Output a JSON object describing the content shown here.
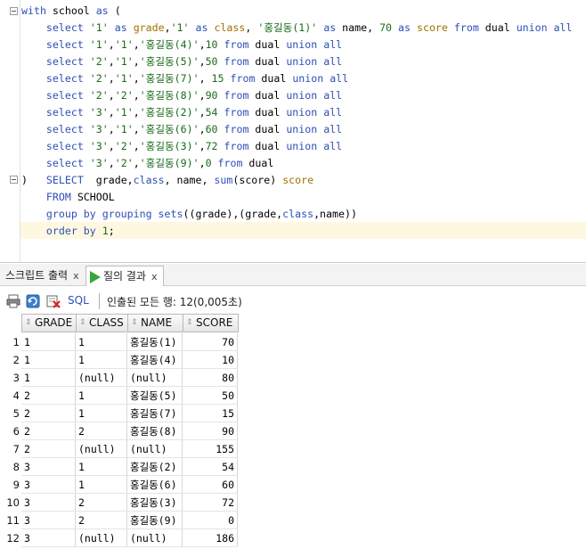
{
  "editor": {
    "lines": [
      [
        [
          "kw",
          "with"
        ],
        [
          "t",
          " school "
        ],
        [
          "kw",
          "as"
        ],
        [
          "t",
          " ("
        ]
      ],
      [
        [
          "t",
          "    "
        ],
        [
          "kw",
          "select"
        ],
        [
          "t",
          " "
        ],
        [
          "str",
          "'1'"
        ],
        [
          "t",
          " "
        ],
        [
          "kw",
          "as"
        ],
        [
          "t",
          " "
        ],
        [
          "ident",
          "grade"
        ],
        [
          "t",
          ","
        ],
        [
          "str",
          "'1'"
        ],
        [
          "t",
          " "
        ],
        [
          "kw",
          "as"
        ],
        [
          "t",
          " "
        ],
        [
          "ident",
          "class"
        ],
        [
          "t",
          ", "
        ],
        [
          "str",
          "'홍길동(1)'"
        ],
        [
          "t",
          " "
        ],
        [
          "kw",
          "as"
        ],
        [
          "t",
          " name, "
        ],
        [
          "num",
          "70"
        ],
        [
          "t",
          " "
        ],
        [
          "kw",
          "as"
        ],
        [
          "t",
          " "
        ],
        [
          "ident",
          "score"
        ],
        [
          "t",
          " "
        ],
        [
          "kw",
          "from"
        ],
        [
          "t",
          " dual "
        ],
        [
          "kw",
          "union all"
        ]
      ],
      [
        [
          "t",
          "    "
        ],
        [
          "kw",
          "select"
        ],
        [
          "t",
          " "
        ],
        [
          "str",
          "'1'"
        ],
        [
          "t",
          ","
        ],
        [
          "str",
          "'1'"
        ],
        [
          "t",
          ","
        ],
        [
          "str",
          "'홍길동(4)'"
        ],
        [
          "t",
          ","
        ],
        [
          "num",
          "10"
        ],
        [
          "t",
          " "
        ],
        [
          "kw",
          "from"
        ],
        [
          "t",
          " dual "
        ],
        [
          "kw",
          "union all"
        ]
      ],
      [
        [
          "t",
          "    "
        ],
        [
          "kw",
          "select"
        ],
        [
          "t",
          " "
        ],
        [
          "str",
          "'2'"
        ],
        [
          "t",
          ","
        ],
        [
          "str",
          "'1'"
        ],
        [
          "t",
          ","
        ],
        [
          "str",
          "'홍길동(5)'"
        ],
        [
          "t",
          ","
        ],
        [
          "num",
          "50"
        ],
        [
          "t",
          " "
        ],
        [
          "kw",
          "from"
        ],
        [
          "t",
          " dual "
        ],
        [
          "kw",
          "union all"
        ]
      ],
      [
        [
          "t",
          "    "
        ],
        [
          "kw",
          "select"
        ],
        [
          "t",
          " "
        ],
        [
          "str",
          "'2'"
        ],
        [
          "t",
          ","
        ],
        [
          "str",
          "'1'"
        ],
        [
          "t",
          ","
        ],
        [
          "str",
          "'홍길동(7)'"
        ],
        [
          "t",
          ", "
        ],
        [
          "num",
          "15"
        ],
        [
          "t",
          " "
        ],
        [
          "kw",
          "from"
        ],
        [
          "t",
          " dual "
        ],
        [
          "kw",
          "union all"
        ]
      ],
      [
        [
          "t",
          "    "
        ],
        [
          "kw",
          "select"
        ],
        [
          "t",
          " "
        ],
        [
          "str",
          "'2'"
        ],
        [
          "t",
          ","
        ],
        [
          "str",
          "'2'"
        ],
        [
          "t",
          ","
        ],
        [
          "str",
          "'홍길동(8)'"
        ],
        [
          "t",
          ","
        ],
        [
          "num",
          "90"
        ],
        [
          "t",
          " "
        ],
        [
          "kw",
          "from"
        ],
        [
          "t",
          " dual "
        ],
        [
          "kw",
          "union all"
        ]
      ],
      [
        [
          "t",
          "    "
        ],
        [
          "kw",
          "select"
        ],
        [
          "t",
          " "
        ],
        [
          "str",
          "'3'"
        ],
        [
          "t",
          ","
        ],
        [
          "str",
          "'1'"
        ],
        [
          "t",
          ","
        ],
        [
          "str",
          "'홍길동(2)'"
        ],
        [
          "t",
          ","
        ],
        [
          "num",
          "54"
        ],
        [
          "t",
          " "
        ],
        [
          "kw",
          "from"
        ],
        [
          "t",
          " dual "
        ],
        [
          "kw",
          "union all"
        ]
      ],
      [
        [
          "t",
          "    "
        ],
        [
          "kw",
          "select"
        ],
        [
          "t",
          " "
        ],
        [
          "str",
          "'3'"
        ],
        [
          "t",
          ","
        ],
        [
          "str",
          "'1'"
        ],
        [
          "t",
          ","
        ],
        [
          "str",
          "'홍길동(6)'"
        ],
        [
          "t",
          ","
        ],
        [
          "num",
          "60"
        ],
        [
          "t",
          " "
        ],
        [
          "kw",
          "from"
        ],
        [
          "t",
          " dual "
        ],
        [
          "kw",
          "union all"
        ]
      ],
      [
        [
          "t",
          "    "
        ],
        [
          "kw",
          "select"
        ],
        [
          "t",
          " "
        ],
        [
          "str",
          "'3'"
        ],
        [
          "t",
          ","
        ],
        [
          "str",
          "'2'"
        ],
        [
          "t",
          ","
        ],
        [
          "str",
          "'홍길동(3)'"
        ],
        [
          "t",
          ","
        ],
        [
          "num",
          "72"
        ],
        [
          "t",
          " "
        ],
        [
          "kw",
          "from"
        ],
        [
          "t",
          " dual "
        ],
        [
          "kw",
          "union all"
        ]
      ],
      [
        [
          "t",
          "    "
        ],
        [
          "kw",
          "select"
        ],
        [
          "t",
          " "
        ],
        [
          "str",
          "'3'"
        ],
        [
          "t",
          ","
        ],
        [
          "str",
          "'2'"
        ],
        [
          "t",
          ","
        ],
        [
          "str",
          "'홍길동(9)'"
        ],
        [
          "t",
          ","
        ],
        [
          "num",
          "0"
        ],
        [
          "t",
          " "
        ],
        [
          "kw",
          "from"
        ],
        [
          "t",
          " dual"
        ]
      ],
      [
        [
          "t",
          ")   "
        ],
        [
          "kw",
          "SELECT"
        ],
        [
          "t",
          "  grade,"
        ],
        [
          "kw",
          "class"
        ],
        [
          "t",
          ", name, "
        ],
        [
          "fn",
          "sum"
        ],
        [
          "t",
          "(score) "
        ],
        [
          "ident",
          "score"
        ]
      ],
      [
        [
          "t",
          "    "
        ],
        [
          "kw",
          "FROM"
        ],
        [
          "t",
          " SCHOOL"
        ]
      ],
      [
        [
          "t",
          "    "
        ],
        [
          "kw",
          "group by grouping sets"
        ],
        [
          "t",
          "((grade),(grade,"
        ],
        [
          "kw",
          "class"
        ],
        [
          "t",
          ",name))"
        ]
      ],
      [
        [
          "t",
          "    "
        ],
        [
          "kw",
          "order by"
        ],
        [
          "t",
          " "
        ],
        [
          "num",
          "1"
        ],
        [
          "t",
          ";"
        ]
      ]
    ]
  },
  "tabs": {
    "script_output": "스크립트 출력",
    "script_close": "x",
    "query_result": "질의 결과",
    "query_close": "x"
  },
  "toolbar": {
    "sql_label": "SQL",
    "status": "인출된 모든 행: 12(0,005초)"
  },
  "grid": {
    "columns": [
      "GRADE",
      "CLASS",
      "NAME",
      "SCORE"
    ],
    "rows": [
      [
        "1",
        "1",
        "홍길동(1)",
        "70"
      ],
      [
        "1",
        "1",
        "홍길동(4)",
        "10"
      ],
      [
        "1",
        "(null)",
        "(null)",
        "80"
      ],
      [
        "2",
        "1",
        "홍길동(5)",
        "50"
      ],
      [
        "2",
        "1",
        "홍길동(7)",
        "15"
      ],
      [
        "2",
        "2",
        "홍길동(8)",
        "90"
      ],
      [
        "2",
        "(null)",
        "(null)",
        "155"
      ],
      [
        "3",
        "1",
        "홍길동(2)",
        "54"
      ],
      [
        "3",
        "1",
        "홍길동(6)",
        "60"
      ],
      [
        "3",
        "2",
        "홍길동(3)",
        "72"
      ],
      [
        "3",
        "2",
        "홍길동(9)",
        "0"
      ],
      [
        "3",
        "(null)",
        "(null)",
        "186"
      ]
    ]
  },
  "colors": {
    "keyword": "#2e4fb8",
    "string": "#1a6b1a",
    "current_line": "#fff8e0"
  }
}
